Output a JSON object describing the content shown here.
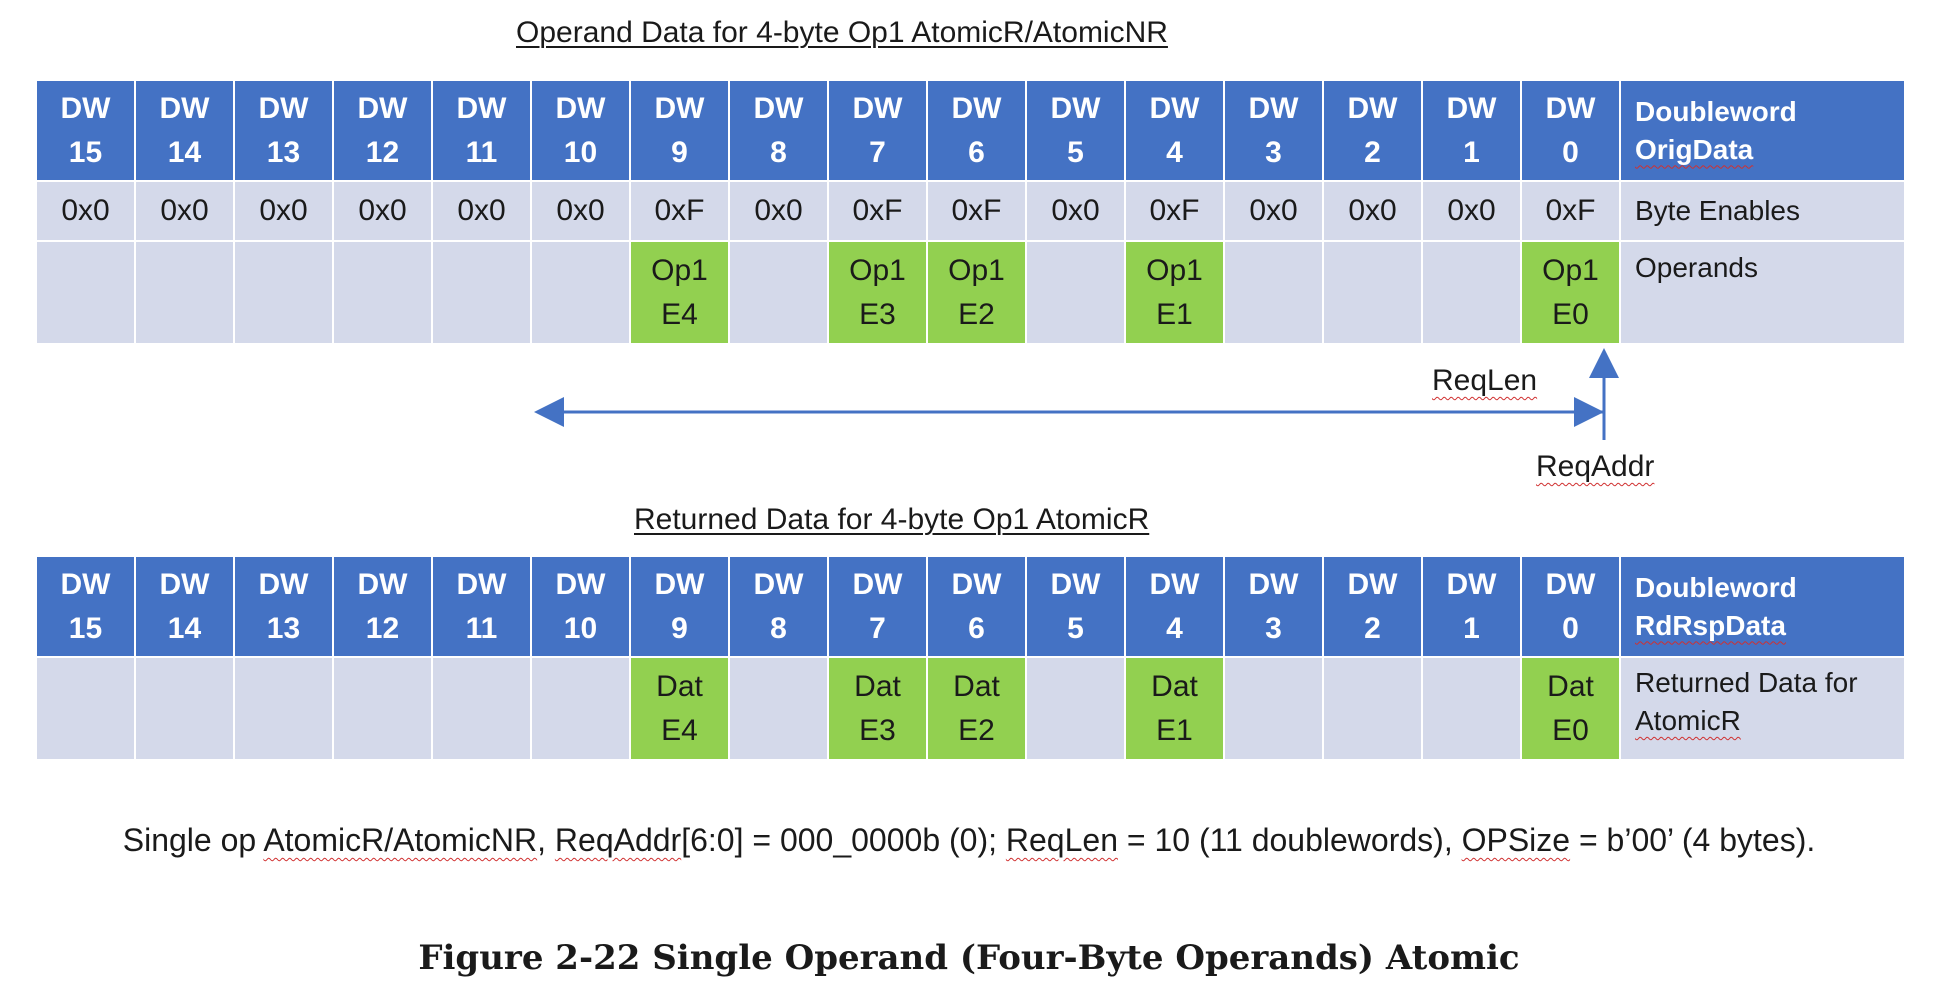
{
  "top": {
    "title": "Operand Data for 4-byte Op1 AtomicR/AtomicNR",
    "header_cells": [
      "DW\n15",
      "DW\n14",
      "DW\n13",
      "DW\n12",
      "DW\n11",
      "DW\n10",
      "DW\n9",
      "DW\n8",
      "DW\n7",
      "DW\n6",
      "DW\n5",
      "DW\n4",
      "DW\n3",
      "DW\n2",
      "DW\n1",
      "DW\n0"
    ],
    "header_label_line1": "Doubleword",
    "header_label_line2": "OrigData",
    "byte_enables": [
      "0x0",
      "0x0",
      "0x0",
      "0x0",
      "0x0",
      "0x0",
      "0xF",
      "0x0",
      "0xF",
      "0xF",
      "0x0",
      "0xF",
      "0x0",
      "0x0",
      "0x0",
      "0xF"
    ],
    "byte_enables_label": "Byte Enables",
    "operands": [
      "",
      "",
      "",
      "",
      "",
      "",
      "Op1\nE4",
      "",
      "Op1\nE3",
      "Op1\nE2",
      "",
      "Op1\nE1",
      "",
      "",
      "",
      "Op1\nE0"
    ],
    "operands_label": "Operands"
  },
  "annotations": {
    "reqlen": "ReqLen",
    "reqaddr": "ReqAddr"
  },
  "bottom": {
    "title": "Returned Data for 4-byte Op1 AtomicR",
    "header_cells": [
      "DW\n15",
      "DW\n14",
      "DW\n13",
      "DW\n12",
      "DW\n11",
      "DW\n10",
      "DW\n9",
      "DW\n8",
      "DW\n7",
      "DW\n6",
      "DW\n5",
      "DW\n4",
      "DW\n3",
      "DW\n2",
      "DW\n1",
      "DW\n0"
    ],
    "header_label_line1": "Doubleword",
    "header_label_line2": "RdRspData",
    "data": [
      "",
      "",
      "",
      "",
      "",
      "",
      "Dat\nE4",
      "",
      "Dat\nE3",
      "Dat\nE2",
      "",
      "Dat\nE1",
      "",
      "",
      "",
      "Dat\nE0"
    ],
    "data_label_line1": "Returned Data for",
    "data_label_line2": "AtomicR"
  },
  "caption": {
    "p1": "Single op ",
    "t1": "AtomicR/AtomicNR",
    "p2": ", ",
    "t2": "ReqAddr",
    "p3": "[6:0] = 000_0000b (0); ",
    "t3": "ReqLen",
    "p4": " = 10 (11 doublewords), ",
    "t4": "OPSize",
    "p5": " = b’00’ (4 bytes)."
  },
  "figure_title": "Figure 2-22 Single Operand (Four-Byte Operands) Atomic",
  "colors": {
    "header": "#4472c4",
    "row": "#d4d9ea",
    "highlight": "#92d050",
    "arrow": "#4472c4"
  }
}
